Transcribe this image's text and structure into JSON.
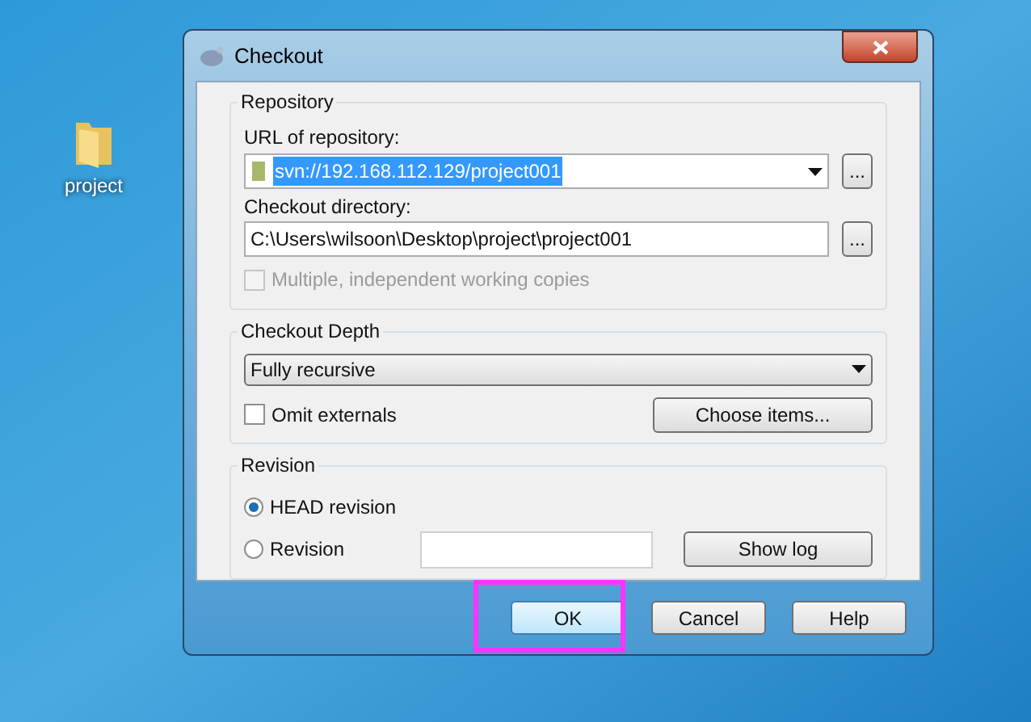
{
  "desktop": {
    "icons": [
      {
        "label": "project"
      }
    ]
  },
  "window": {
    "title": "Checkout"
  },
  "repository": {
    "title": "Repository",
    "url_label": "URL of repository:",
    "url_value": "svn://192.168.112.129/project001",
    "url_selected": true,
    "directory_label": "Checkout directory:",
    "directory_value": "C:\\Users\\wilsoon\\Desktop\\project\\project001",
    "browse_buttons": [
      "...",
      "..."
    ],
    "multiple_copies": {
      "label": "Multiple, independent working copies",
      "checked": false,
      "disabled": true
    }
  },
  "checkout_depth": {
    "title": "Checkout Depth",
    "value": "Fully recursive",
    "omit_externals": {
      "label": "Omit externals",
      "checked": false,
      "disabled": false
    },
    "choose_button": "Choose items..."
  },
  "revision": {
    "title": "Revision",
    "options": [
      {
        "label": "HEAD revision",
        "selected": true
      },
      {
        "label": "Revision",
        "selected": false
      }
    ],
    "show_log_button": "Show log"
  },
  "buttons": [
    {
      "label": "OK",
      "default": true,
      "highlighted": true
    },
    {
      "label": "Cancel",
      "default": false,
      "highlighted": false
    },
    {
      "label": "Help",
      "default": false,
      "highlighted": false
    }
  ]
}
